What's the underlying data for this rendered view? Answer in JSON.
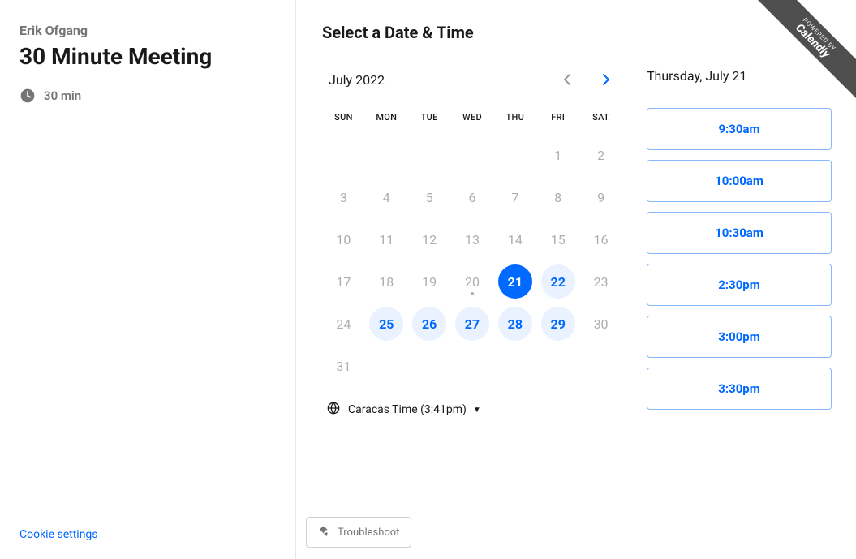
{
  "sidebar": {
    "host": "Erik Ofgang",
    "title": "30 Minute Meeting",
    "duration": "30 min",
    "cookie_link": "Cookie settings"
  },
  "main": {
    "header": "Select a Date & Time",
    "month_label": "July 2022",
    "dow": [
      "SUN",
      "MON",
      "TUE",
      "WED",
      "THU",
      "FRI",
      "SAT"
    ],
    "weeks": [
      [
        {
          "n": ""
        },
        {
          "n": ""
        },
        {
          "n": ""
        },
        {
          "n": ""
        },
        {
          "n": ""
        },
        {
          "n": "1"
        },
        {
          "n": "2"
        }
      ],
      [
        {
          "n": "3"
        },
        {
          "n": "4"
        },
        {
          "n": "5"
        },
        {
          "n": "6"
        },
        {
          "n": "7"
        },
        {
          "n": "8"
        },
        {
          "n": "9"
        }
      ],
      [
        {
          "n": "10"
        },
        {
          "n": "11"
        },
        {
          "n": "12"
        },
        {
          "n": "13"
        },
        {
          "n": "14"
        },
        {
          "n": "15"
        },
        {
          "n": "16"
        }
      ],
      [
        {
          "n": "17"
        },
        {
          "n": "18"
        },
        {
          "n": "19"
        },
        {
          "n": "20",
          "today": true
        },
        {
          "n": "21",
          "selected": true
        },
        {
          "n": "22",
          "available": true
        },
        {
          "n": "23"
        }
      ],
      [
        {
          "n": "24"
        },
        {
          "n": "25",
          "available": true
        },
        {
          "n": "26",
          "available": true
        },
        {
          "n": "27",
          "available": true
        },
        {
          "n": "28",
          "available": true
        },
        {
          "n": "29",
          "available": true
        },
        {
          "n": "30"
        }
      ],
      [
        {
          "n": "31"
        },
        {
          "n": ""
        },
        {
          "n": ""
        },
        {
          "n": ""
        },
        {
          "n": ""
        },
        {
          "n": ""
        },
        {
          "n": ""
        }
      ]
    ],
    "timezone_label": "Caracas Time (3:41pm)",
    "selected_date": "Thursday, July 21",
    "timeslots": [
      "9:30am",
      "10:00am",
      "10:30am",
      "2:30pm",
      "3:00pm",
      "3:30pm"
    ],
    "troubleshoot": "Troubleshoot"
  },
  "badge": {
    "small": "POWERED BY",
    "big": "Calendly"
  }
}
